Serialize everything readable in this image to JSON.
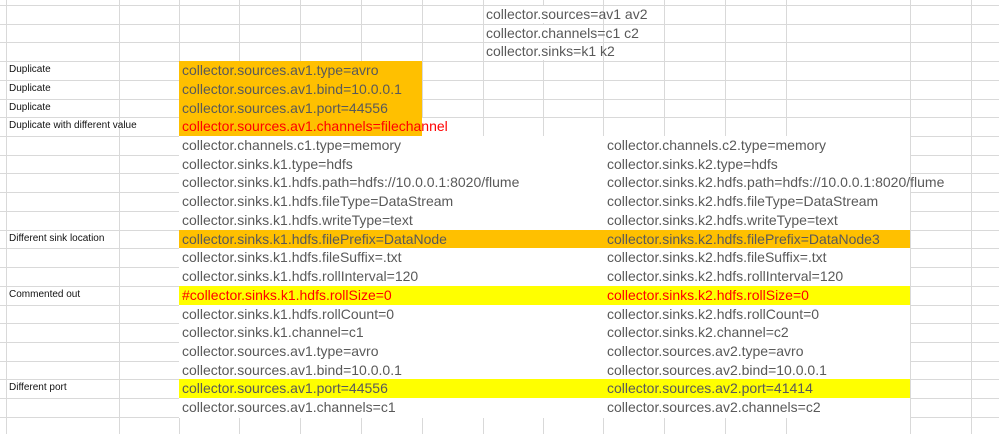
{
  "colors": {
    "orange": "#FFC000",
    "yellow": "#FFFF00",
    "text": "#595959",
    "red": "#FF0000"
  },
  "header_rows": [
    "collector.sources=av1 av2",
    "collector.channels=c1 c2",
    "collector.sinks=k1 k2"
  ],
  "rows": [
    {
      "label": "Duplicate",
      "left": "collector.sources.av1.type=avro",
      "right": "",
      "highlight": "orange-left",
      "red": false
    },
    {
      "label": "Duplicate",
      "left": "collector.sources.av1.bind=10.0.0.1",
      "right": "",
      "highlight": "orange-left",
      "red": false
    },
    {
      "label": "Duplicate",
      "left": "collector.sources.av1.port=44556",
      "right": "",
      "highlight": "orange-left",
      "red": false
    },
    {
      "label": "Duplicate with different value",
      "left": "collector.sources.av1.channels=filechannel",
      "right": "",
      "highlight": "orange-left",
      "red": true
    },
    {
      "label": "",
      "left": "collector.channels.c1.type=memory",
      "right": "collector.channels.c2.type=memory",
      "highlight": "white",
      "red": false
    },
    {
      "label": "",
      "left": "collector.sinks.k1.type=hdfs",
      "right": "collector.sinks.k2.type=hdfs",
      "highlight": "white",
      "red": false
    },
    {
      "label": "",
      "left": "collector.sinks.k1.hdfs.path=hdfs://10.0.0.1:8020/flume",
      "right": "collector.sinks.k2.hdfs.path=hdfs://10.0.0.1:8020/flume",
      "highlight": "white",
      "red": false
    },
    {
      "label": "",
      "left": "collector.sinks.k1.hdfs.fileType=DataStream",
      "right": "collector.sinks.k2.hdfs.fileType=DataStream",
      "highlight": "white",
      "red": false
    },
    {
      "label": "",
      "left": "collector.sinks.k1.hdfs.writeType=text",
      "right": "collector.sinks.k2.hdfs.writeType=text",
      "highlight": "white",
      "red": false
    },
    {
      "label": "Different sink location",
      "left": "collector.sinks.k1.hdfs.filePrefix=DataNode",
      "right": "collector.sinks.k2.hdfs.filePrefix=DataNode3",
      "highlight": "orange",
      "red": false
    },
    {
      "label": "",
      "left": "collector.sinks.k1.hdfs.fileSuffix=.txt",
      "right": "collector.sinks.k2.hdfs.fileSuffix=.txt",
      "highlight": "white",
      "red": false
    },
    {
      "label": "",
      "left": "collector.sinks.k1.hdfs.rollInterval=120",
      "right": "collector.sinks.k2.hdfs.rollInterval=120",
      "highlight": "white",
      "red": false
    },
    {
      "label": "Commented out",
      "left": "#collector.sinks.k1.hdfs.rollSize=0",
      "right": "collector.sinks.k2.hdfs.rollSize=0",
      "highlight": "yellow",
      "red": true
    },
    {
      "label": "",
      "left": "collector.sinks.k1.hdfs.rollCount=0",
      "right": "collector.sinks.k2.hdfs.rollCount=0",
      "highlight": "white",
      "red": false
    },
    {
      "label": "",
      "left": "collector.sinks.k1.channel=c1",
      "right": "collector.sinks.k2.channel=c2",
      "highlight": "white",
      "red": false
    },
    {
      "label": "",
      "left": "collector.sources.av1.type=avro",
      "right": "collector.sources.av2.type=avro",
      "highlight": "white",
      "red": false
    },
    {
      "label": "",
      "left": "collector.sources.av1.bind=10.0.0.1",
      "right": "collector.sources.av2.bind=10.0.0.1",
      "highlight": "white",
      "red": false
    },
    {
      "label": "Different port",
      "left": "collector.sources.av1.port=44556",
      "right": "collector.sources.av2.port=41414",
      "highlight": "yellow",
      "red": false
    },
    {
      "label": "",
      "left": "collector.sources.av1.channels=c1",
      "right": "collector.sources.av2.channels=c2",
      "highlight": "white",
      "red": false
    }
  ]
}
